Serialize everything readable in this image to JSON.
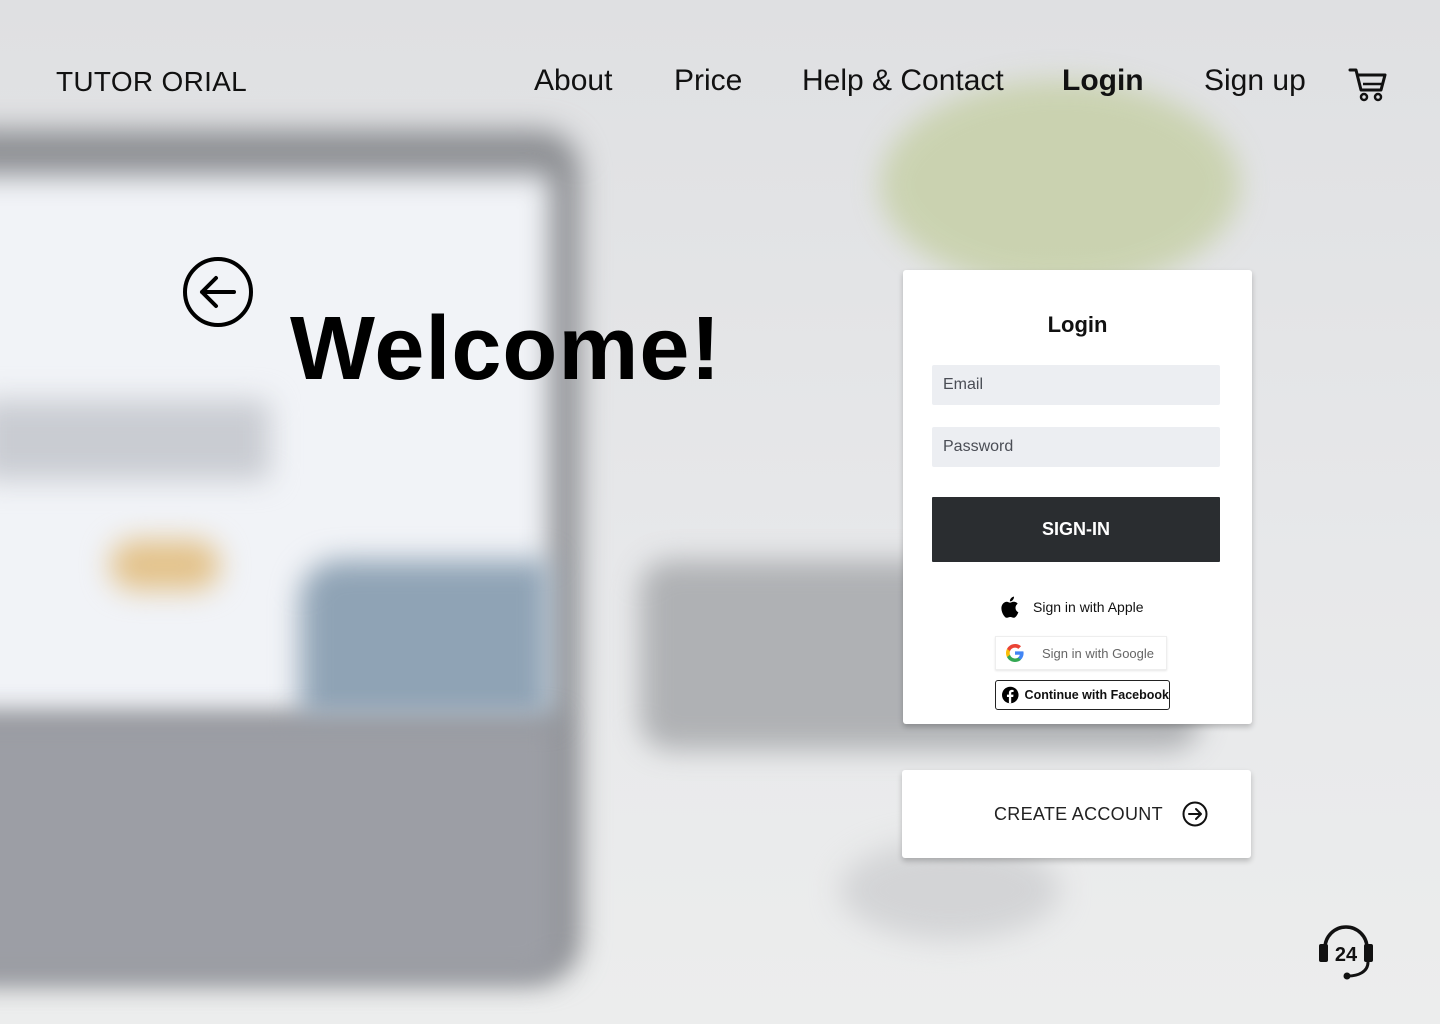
{
  "brand": {
    "logo": "TUTOR ORIAL"
  },
  "nav": {
    "links": [
      "About",
      "Price",
      "Help & Contact",
      "Login",
      "Sign up"
    ],
    "active": "Login",
    "cart_icon": "shopping-cart-icon"
  },
  "hero": {
    "title": "Welcome!",
    "back_icon": "arrow-left-circle-icon"
  },
  "login": {
    "title": "Login",
    "email_placeholder": "Email",
    "password_placeholder": "Password",
    "submit_label": "SIGN-IN",
    "apple_label": "Sign in with Apple",
    "google_label": "Sign in with Google",
    "facebook_label": "Continue with Facebook"
  },
  "create_account": {
    "label": "CREATE ACCOUNT",
    "icon": "arrow-right-circle-icon"
  },
  "support": {
    "icon": "support-24-headset-icon",
    "text": "24"
  },
  "colors": {
    "signin_bg": "#2a2d30",
    "field_bg": "#eceef2",
    "text": "#111111"
  }
}
